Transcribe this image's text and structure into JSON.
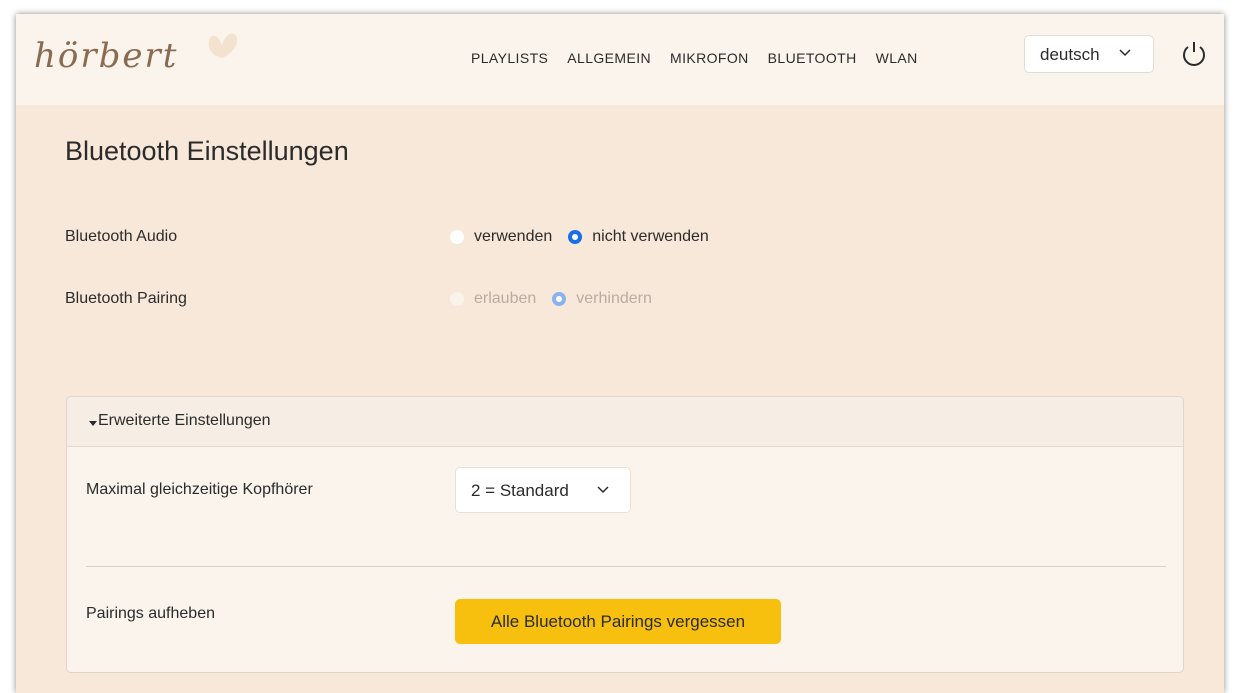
{
  "header": {
    "logo_text": "hörbert",
    "nav": [
      "PLAYLISTS",
      "ALLGEMEIN",
      "MIKROFON",
      "BLUETOOTH",
      "WLAN"
    ],
    "language": {
      "selected": "deutsch"
    },
    "icons": {
      "power": "power-icon",
      "chevron": "chevron-down-icon",
      "logo_decoration": "butterfly-icon"
    }
  },
  "page": {
    "title": "Bluetooth Einstellungen",
    "bluetooth_audio": {
      "label": "Bluetooth Audio",
      "options": [
        "verwenden",
        "nicht verwenden"
      ],
      "selected": "nicht verwenden"
    },
    "bluetooth_pairing": {
      "label": "Bluetooth Pairing",
      "options": [
        "erlauben",
        "verhindern"
      ],
      "selected": "verhindern",
      "disabled": true
    }
  },
  "advanced": {
    "title": "Erweiterte Einstellungen",
    "max_headphones": {
      "label": "Maximal gleichzeitige Kopfhörer",
      "selected": "2 = Standard"
    },
    "pairings": {
      "label": "Pairings aufheben",
      "button": "Alle Bluetooth Pairings vergessen"
    }
  },
  "colors": {
    "background": "#f8e8da",
    "header": "#fbf4ec",
    "accent_blue": "#1a6ee6",
    "button_yellow": "#f8c00e"
  }
}
